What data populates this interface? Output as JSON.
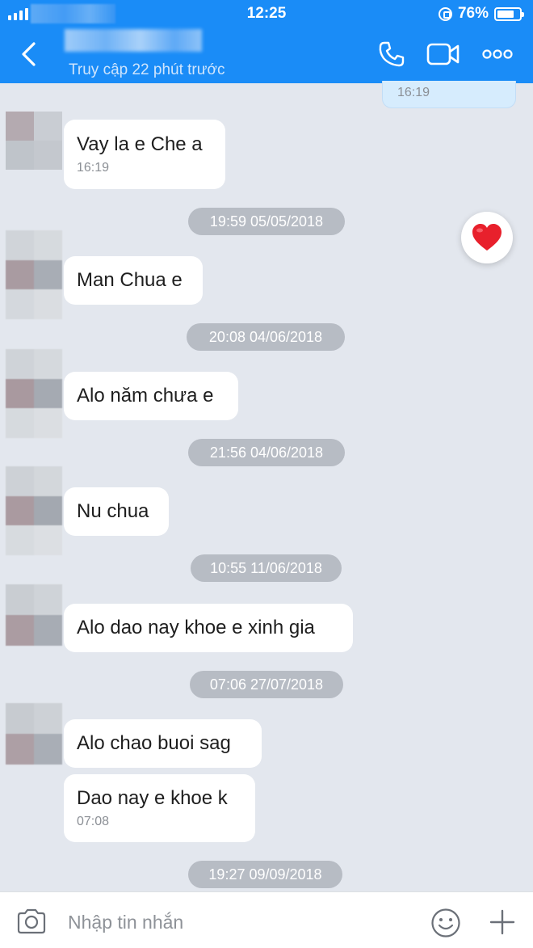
{
  "status_bar": {
    "time": "12:25",
    "battery": "76%"
  },
  "header": {
    "subtitle": "Truy cập 22 phút trước"
  },
  "conversation": {
    "sent_partial_time": "16:19",
    "messages": [
      {
        "text": "Vay la e Che a",
        "time": "16:19"
      },
      {
        "separator": "19:59 05/05/2018"
      },
      {
        "text": "Man Chua e"
      },
      {
        "separator": "20:08 04/06/2018"
      },
      {
        "text": "Alo năm chưa e"
      },
      {
        "separator": "21:56 04/06/2018"
      },
      {
        "text": "Nu chua"
      },
      {
        "separator": "10:55 11/06/2018"
      },
      {
        "text": "Alo dao nay khoe e xinh gia"
      },
      {
        "separator": "07:06 27/07/2018"
      },
      {
        "text": "Alo chao buoi sag"
      },
      {
        "text": "Dao nay e khoe k",
        "time": "07:08"
      },
      {
        "separator": "19:27 09/09/2018"
      }
    ]
  },
  "input_bar": {
    "placeholder": "Nhập tin nhắn"
  },
  "colors": {
    "header_blue": "#1a8cf7",
    "chat_background": "#e3e7ee",
    "date_pill": "#b7bcc4",
    "sent_bubble": "#d6ecfd",
    "heart": "#e8202c"
  },
  "icons": [
    "back-icon",
    "phone-icon",
    "video-call-icon",
    "more-icon",
    "heart-icon",
    "camera-icon",
    "emoji-icon",
    "plus-icon"
  ]
}
